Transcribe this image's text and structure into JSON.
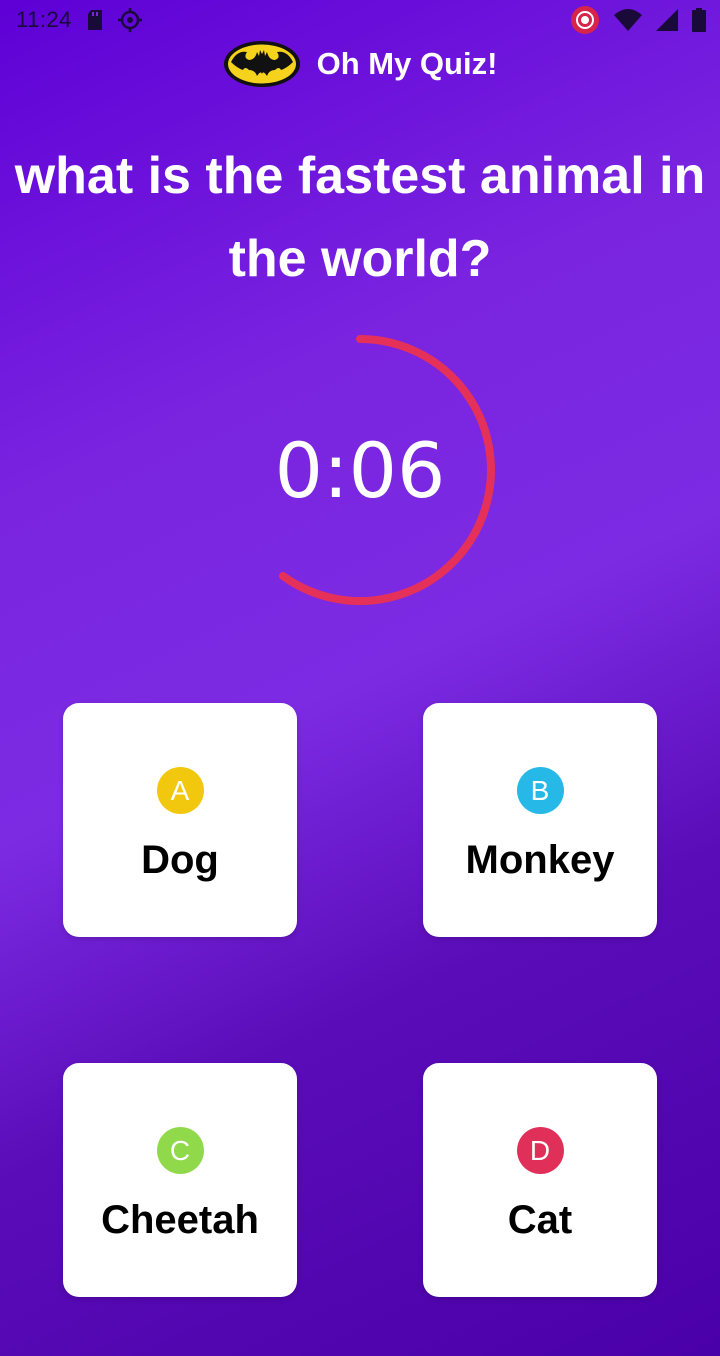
{
  "status_bar": {
    "time": "11:24",
    "left_icons": [
      "sd-card-icon",
      "crosshair-icon"
    ],
    "right_icons": [
      "record-icon",
      "wifi-icon",
      "signal-icon",
      "battery-icon"
    ]
  },
  "header": {
    "logo_icon": "batman-logo-icon",
    "title": "Oh My Quiz!"
  },
  "question": {
    "text": "what is the fastest animal in the world?"
  },
  "timer": {
    "text": "0:06",
    "remaining_fraction": 0.6,
    "color": "#e5305a"
  },
  "answers": [
    {
      "letter": "A",
      "label": "Dog",
      "color": "#f2c80f"
    },
    {
      "letter": "B",
      "label": "Monkey",
      "color": "#26b8e6"
    },
    {
      "letter": "C",
      "label": "Cheetah",
      "color": "#8fd94a"
    },
    {
      "letter": "D",
      "label": "Cat",
      "color": "#e0305a"
    }
  ]
}
